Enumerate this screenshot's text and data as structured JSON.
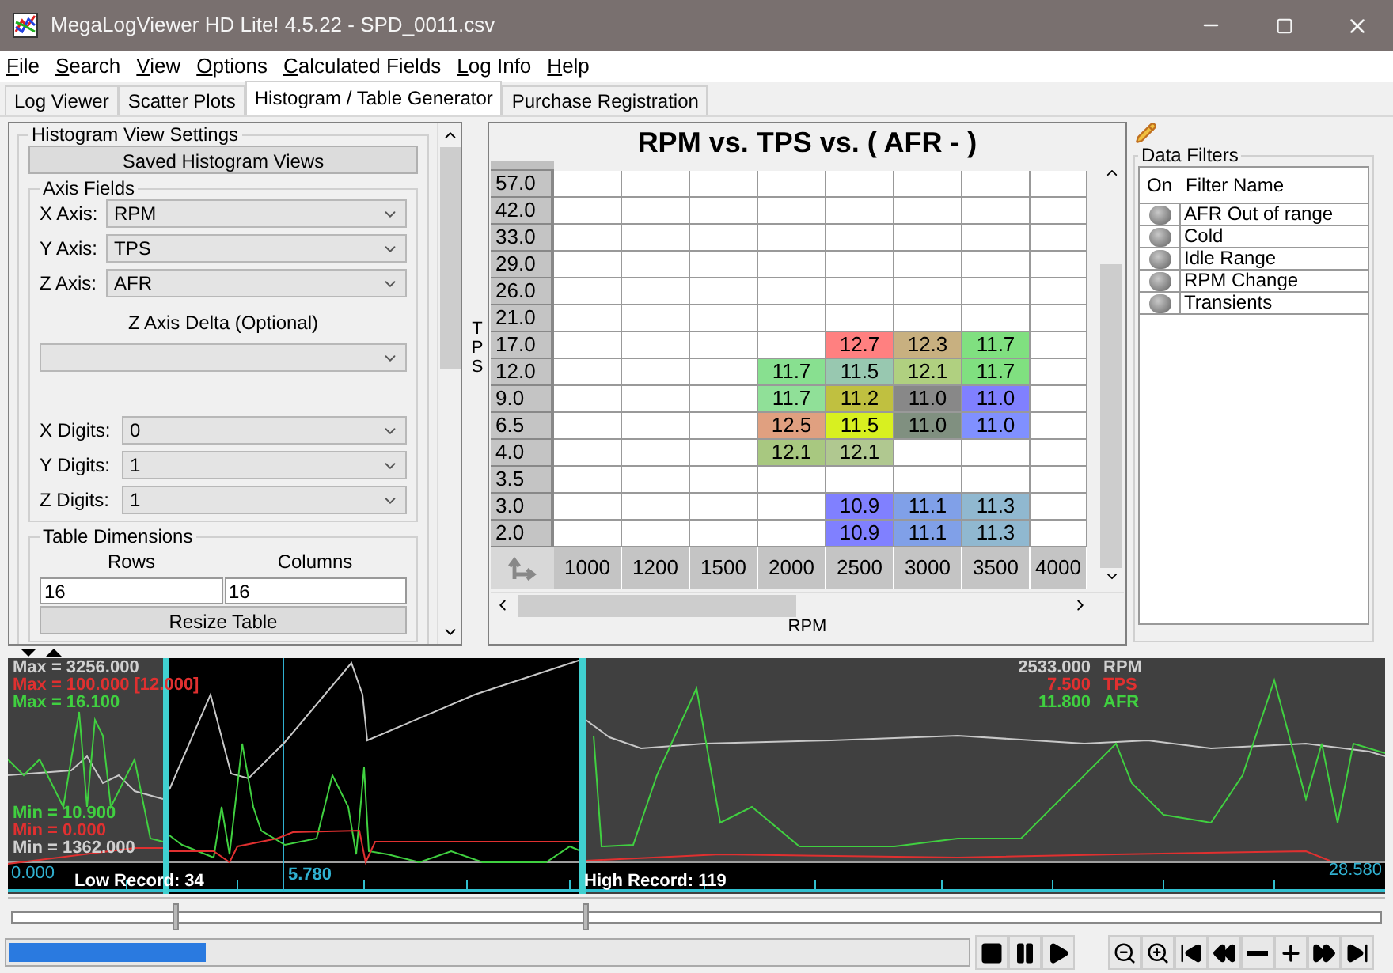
{
  "window": {
    "title": "MegaLogViewer HD Lite! 4.5.22 - SPD_0011.csv"
  },
  "menu": [
    "File",
    "Search",
    "View",
    "Options",
    "Calculated Fields",
    "Log Info",
    "Help"
  ],
  "tabs": [
    {
      "label": "Log Viewer",
      "selected": false
    },
    {
      "label": "Scatter Plots",
      "selected": false
    },
    {
      "label": "Histogram / Table Generator",
      "selected": true
    },
    {
      "label": "Purchase Registration",
      "selected": false
    }
  ],
  "settings": {
    "title": "Histogram View Settings",
    "saved_views_button": "Saved Histogram Views",
    "axis_fields": {
      "title": "Axis Fields",
      "axes": [
        {
          "label": "X Axis:",
          "value": "RPM"
        },
        {
          "label": "Y Axis:",
          "value": "TPS"
        },
        {
          "label": "Z Axis:",
          "value": "AFR"
        }
      ],
      "delta_label": "Z Axis Delta (Optional)",
      "digits": [
        {
          "label": "X Digits:",
          "value": "0"
        },
        {
          "label": "Y Digits:",
          "value": "1"
        },
        {
          "label": "Z Digits:",
          "value": "1"
        }
      ]
    },
    "table_dimensions": {
      "title": "Table Dimensions",
      "rows_label": "Rows",
      "columns_label": "Columns",
      "rows": "16",
      "columns": "16",
      "resize_button": "Resize Table"
    }
  },
  "histogram": {
    "title": "RPM vs. TPS vs. ( AFR -   )",
    "y_label": "TPS",
    "x_label": "RPM",
    "columns": [
      "1000",
      "1200",
      "1500",
      "2000",
      "2500",
      "3000",
      "3500",
      "4000"
    ],
    "rows": [
      {
        "label": "57.0"
      },
      {
        "label": "42.0"
      },
      {
        "label": "33.0"
      },
      {
        "label": "29.0"
      },
      {
        "label": "26.0"
      },
      {
        "label": "21.0"
      },
      {
        "label": "17.0",
        "cells": [
          {},
          {},
          {},
          {},
          {
            "value": "12.7",
            "color": "#ff8080"
          },
          {
            "value": "12.3",
            "color": "#c8b080"
          },
          {
            "value": "11.7",
            "color": "#80e080"
          },
          {}
        ]
      },
      {
        "label": "12.0",
        "cells": [
          {},
          {},
          {},
          {
            "value": "11.7",
            "color": "#88e090"
          },
          {
            "value": "11.5",
            "color": "#98c8b0"
          },
          {
            "value": "12.1",
            "color": "#b0d080"
          },
          {
            "value": "11.7",
            "color": "#80e080"
          },
          {}
        ]
      },
      {
        "label": "9.0",
        "cells": [
          {},
          {},
          {},
          {
            "value": "11.7",
            "color": "#90e098"
          },
          {
            "value": "11.2",
            "color": "#c0c040"
          },
          {
            "value": "11.0",
            "color": "#888888"
          },
          {
            "value": "11.0",
            "color": "#8080ff"
          },
          {}
        ]
      },
      {
        "label": "6.5",
        "cells": [
          {},
          {},
          {},
          {
            "value": "12.5",
            "color": "#e0a080"
          },
          {
            "value": "11.5",
            "color": "#d8f020"
          },
          {
            "value": "11.0",
            "color": "#809080"
          },
          {
            "value": "11.0",
            "color": "#8090ff"
          },
          {}
        ]
      },
      {
        "label": "4.0",
        "cells": [
          {},
          {},
          {},
          {
            "value": "12.1",
            "color": "#a8c880"
          },
          {
            "value": "12.1",
            "color": "#b0c890"
          },
          {},
          {},
          {}
        ]
      },
      {
        "label": "3.5"
      },
      {
        "label": "3.0",
        "cells": [
          {},
          {},
          {},
          {},
          {
            "value": "10.9",
            "color": "#8080ff"
          },
          {
            "value": "11.1",
            "color": "#80a0e8"
          },
          {
            "value": "11.3",
            "color": "#90b8d0"
          },
          {}
        ]
      },
      {
        "label": "2.0",
        "cells": [
          {},
          {},
          {},
          {},
          {
            "value": "10.9",
            "color": "#8080ff"
          },
          {
            "value": "11.1",
            "color": "#80a0e8"
          },
          {
            "value": "11.3",
            "color": "#90b8d0"
          },
          {}
        ]
      }
    ]
  },
  "filters": {
    "title": "Data Filters",
    "columns": [
      "On",
      "Filter Name"
    ],
    "items": [
      {
        "name": "AFR Out of range",
        "on": false
      },
      {
        "name": "Cold",
        "on": false
      },
      {
        "name": "Idle Range",
        "on": false
      },
      {
        "name": "RPM Change",
        "on": false
      },
      {
        "name": "Transients",
        "on": false
      }
    ]
  },
  "graph": {
    "max": [
      {
        "text": "Max = 3256.000",
        "color": "#d0d0d0"
      },
      {
        "text": "Max = 100.000 [12.000]",
        "color": "#e03030"
      },
      {
        "text": "Max = 16.100",
        "color": "#40d040"
      }
    ],
    "min": [
      {
        "text": "Min = 10.900",
        "color": "#40d040"
      },
      {
        "text": "Min = 0.000",
        "color": "#e03030"
      },
      {
        "text": "Min = 1362.000",
        "color": "#d0d0d0"
      }
    ],
    "current": [
      {
        "value": "2533.000",
        "name": "RPM",
        "color": "#d0d0d0"
      },
      {
        "value": "7.500",
        "name": "TPS",
        "color": "#e03030"
      },
      {
        "value": "11.800",
        "name": "AFR",
        "color": "#40d040"
      }
    ],
    "start_time": "0.000",
    "cursor_time": "5.780",
    "end_time": "28.580",
    "low_record": "Low Record: 34",
    "high_record": "High Record: 119"
  },
  "range_slider": {
    "thumbs": [
      {
        "level": 0.12
      },
      {
        "level": 0.417
      }
    ]
  },
  "progress": {
    "level": 0.205
  },
  "player_buttons": [
    {
      "kind": "stop"
    },
    {
      "kind": "pause"
    },
    {
      "kind": "play"
    },
    {
      "kind": "gap"
    },
    {
      "kind": "zoom-out"
    },
    {
      "kind": "zoom-in"
    },
    {
      "kind": "first"
    },
    {
      "kind": "rewind"
    },
    {
      "kind": "minus"
    },
    {
      "kind": "plus"
    },
    {
      "kind": "forward"
    },
    {
      "kind": "last"
    }
  ]
}
